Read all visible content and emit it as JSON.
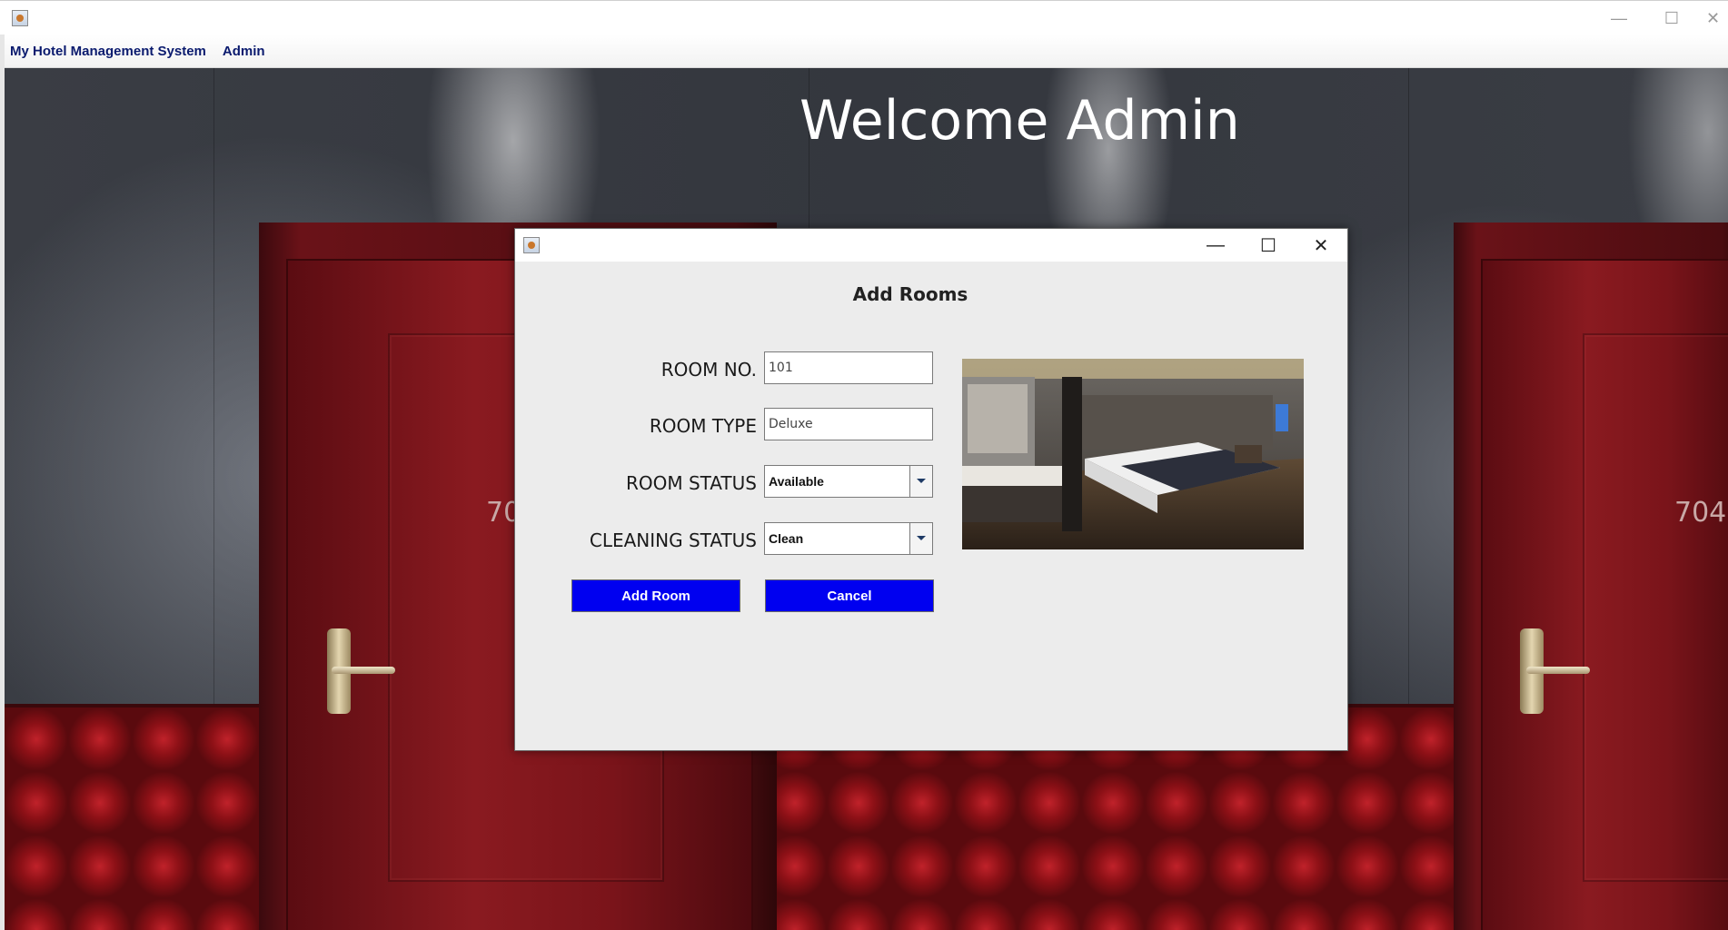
{
  "window": {
    "controls": {
      "minimize": "—",
      "maximize": "☐",
      "close": "✕"
    }
  },
  "menubar": {
    "items": [
      {
        "label": "My Hotel Management System"
      },
      {
        "label": "Admin"
      }
    ]
  },
  "background": {
    "welcome_text": "Welcome Admin",
    "door_numbers": [
      "70",
      "704"
    ]
  },
  "dialog": {
    "controls": {
      "minimize": "—",
      "maximize": "☐",
      "close": "✕"
    },
    "heading": "Add Rooms",
    "fields": {
      "room_no": {
        "label": "ROOM NO.",
        "value": "101"
      },
      "room_type": {
        "label": "ROOM TYPE",
        "value": "Deluxe"
      },
      "room_status": {
        "label": "ROOM STATUS",
        "selected": "Available"
      },
      "cleaning_status": {
        "label": "CLEANING STATUS",
        "selected": "Clean"
      }
    },
    "buttons": {
      "add": "Add Room",
      "cancel": "Cancel"
    }
  },
  "colors": {
    "button_bg": "#0000f0",
    "menu_text": "#0a1a6e",
    "dialog_bg": "#ececec"
  }
}
